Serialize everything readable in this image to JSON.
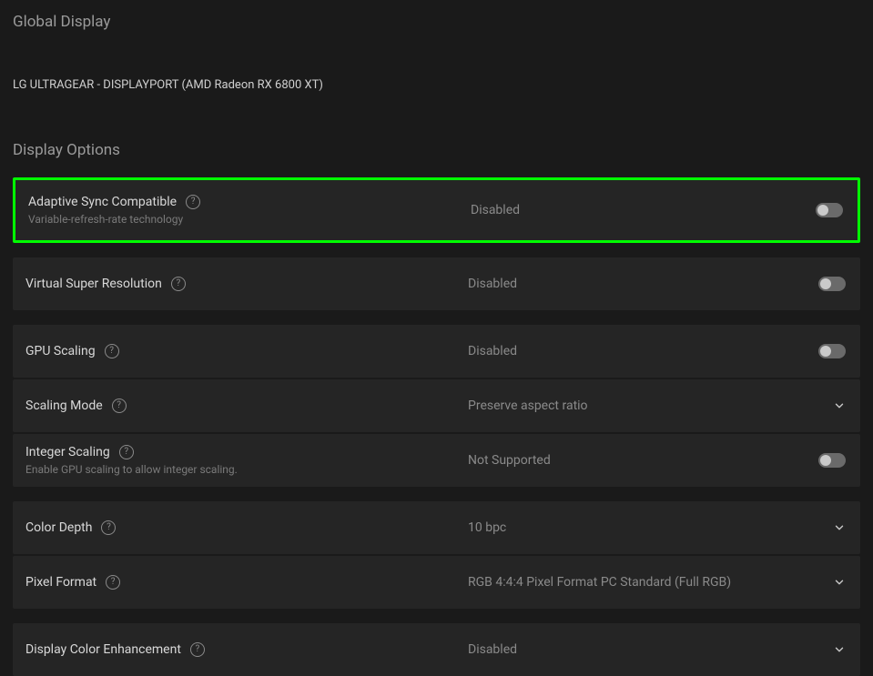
{
  "header": {
    "global_title": "Global Display",
    "display_name": "LG ULTRAGEAR - DISPLAYPORT (AMD Radeon RX 6800 XT)",
    "section_title": "Display Options"
  },
  "rows": {
    "adaptive_sync": {
      "label": "Adaptive Sync Compatible",
      "sub": "Variable-refresh-rate technology",
      "value": "Disabled"
    },
    "vsr": {
      "label": "Virtual Super Resolution",
      "value": "Disabled"
    },
    "gpu_scaling": {
      "label": "GPU Scaling",
      "value": "Disabled"
    },
    "scaling_mode": {
      "label": "Scaling Mode",
      "value": "Preserve aspect ratio"
    },
    "integer_scaling": {
      "label": "Integer Scaling",
      "sub": "Enable GPU scaling to allow integer scaling.",
      "value": "Not Supported"
    },
    "color_depth": {
      "label": "Color Depth",
      "value": "10 bpc"
    },
    "pixel_format": {
      "label": "Pixel Format",
      "value": "RGB 4:4:4 Pixel Format PC Standard (Full RGB)"
    },
    "color_enhancement": {
      "label": "Display Color Enhancement",
      "value": "Disabled"
    }
  }
}
